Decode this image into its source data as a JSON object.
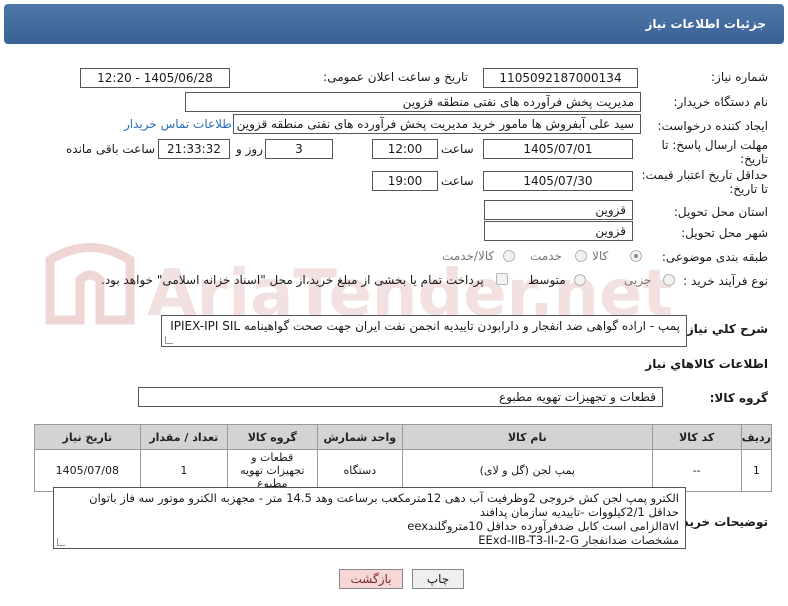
{
  "header": {
    "title": "جزئیات اطلاعات نیاز"
  },
  "form": {
    "need_number_label": "شماره نیاز:",
    "need_number": "1105092187000134",
    "announce_label": "تاریخ و ساعت اعلان عمومی:",
    "announce_value": "1405/06/28 - 12:20",
    "buyer_org_label": "نام دستگاه خریدار:",
    "buyer_org": "مدیریت پخش فرآورده های نفتی منطقه قزوین",
    "creator_label": "ایجاد کننده درخواست:",
    "creator": "سید علی  آبفروش ها مامور خرید مدیریت پخش فرآورده های نفتی منطقه قزوین",
    "contact_link": "اطلاعات تماس خریدار",
    "deadline_label_1": "مهلت ارسال پاسخ: تا",
    "deadline_label_2": "تاریخ:",
    "deadline_date": "1405/07/01",
    "time_label": "ساعت",
    "deadline_time": "12:00",
    "days_value": "3",
    "days_label": "روز و",
    "remaining_value": "21:33:32",
    "remaining_label": "ساعت باقی مانده",
    "validity_label_1": "حداقل تاریخ اعتبار قیمت:",
    "validity_label_2": "تا تاریخ:",
    "validity_date": "1405/07/30",
    "validity_time": "19:00",
    "province_label": "استان محل تحویل:",
    "province": "قزوین",
    "city_label": "شهر محل تحویل:",
    "city": "قزوین",
    "category_label": "طبقه بندی موضوعی:",
    "category_options": [
      "کالا",
      "خدمت",
      "کالا/خدمت"
    ],
    "category_selected": "کالا",
    "process_label": "نوع فرآیند خرید :",
    "process_options": [
      "جزیی",
      "متوسط"
    ],
    "payment_note": "پرداخت تمام یا بخشی از مبلغ خرید،از محل \"اسناد خزانه اسلامی\" خواهد بود.",
    "description_label": "شرح کلي نياز:",
    "description": "پمپ - اراده گواهی ضد  انفجار و دارابودن تاییدیه انجمن نفت ایران جهت صحت گواهینامه IPIEX-IPI SIL"
  },
  "goods": {
    "section_title": "اطلاعات کالاهاي نياز",
    "group_label": "گروه کالا:",
    "group_value": "قطعات و تجهیزات تهویه مطبوع",
    "columns": [
      "رديف",
      "کد کالا",
      "نام کالا",
      "واحد شمارش",
      "گروه کالا",
      "تعداد / مقدار",
      "تاریخ نیاز"
    ],
    "rows": [
      {
        "row": "1",
        "code": "--",
        "name": "پمپ لجن (گل و لای)",
        "unit": "دستگاه",
        "group": "قطعات و تجهیزات تهویه مطبوع",
        "qty": "1",
        "date": "1405/07/08"
      }
    ]
  },
  "buyer_notes": {
    "label": "توضیحات خریدار:",
    "lines": [
      "الکترو پمپ لجن کش خروجی 2وظرفیت آب دهی 12مترمکعب برساعت وهد 14.5 متر - مجهزبه الکترو موتور سه فاز باتوان",
      "حداقل 2/1کیلووات  -تاییدیه سازمان پدافند",
      "avlالزامی است کابل ضدفرآورده حداقل 10متروگلندeex",
      "مشخصات ضدانفجار EExd-IIB-T3-II-2-G"
    ]
  },
  "buttons": {
    "print": "چاپ",
    "back": "بازگشت"
  },
  "watermark_text": "AriaTender.net",
  "colors": {
    "header_bg": "#3f6899",
    "link": "#2c6fbf",
    "back_btn_bg": "#f7d6d6",
    "table_header_bg": "#d3d3d3"
  }
}
